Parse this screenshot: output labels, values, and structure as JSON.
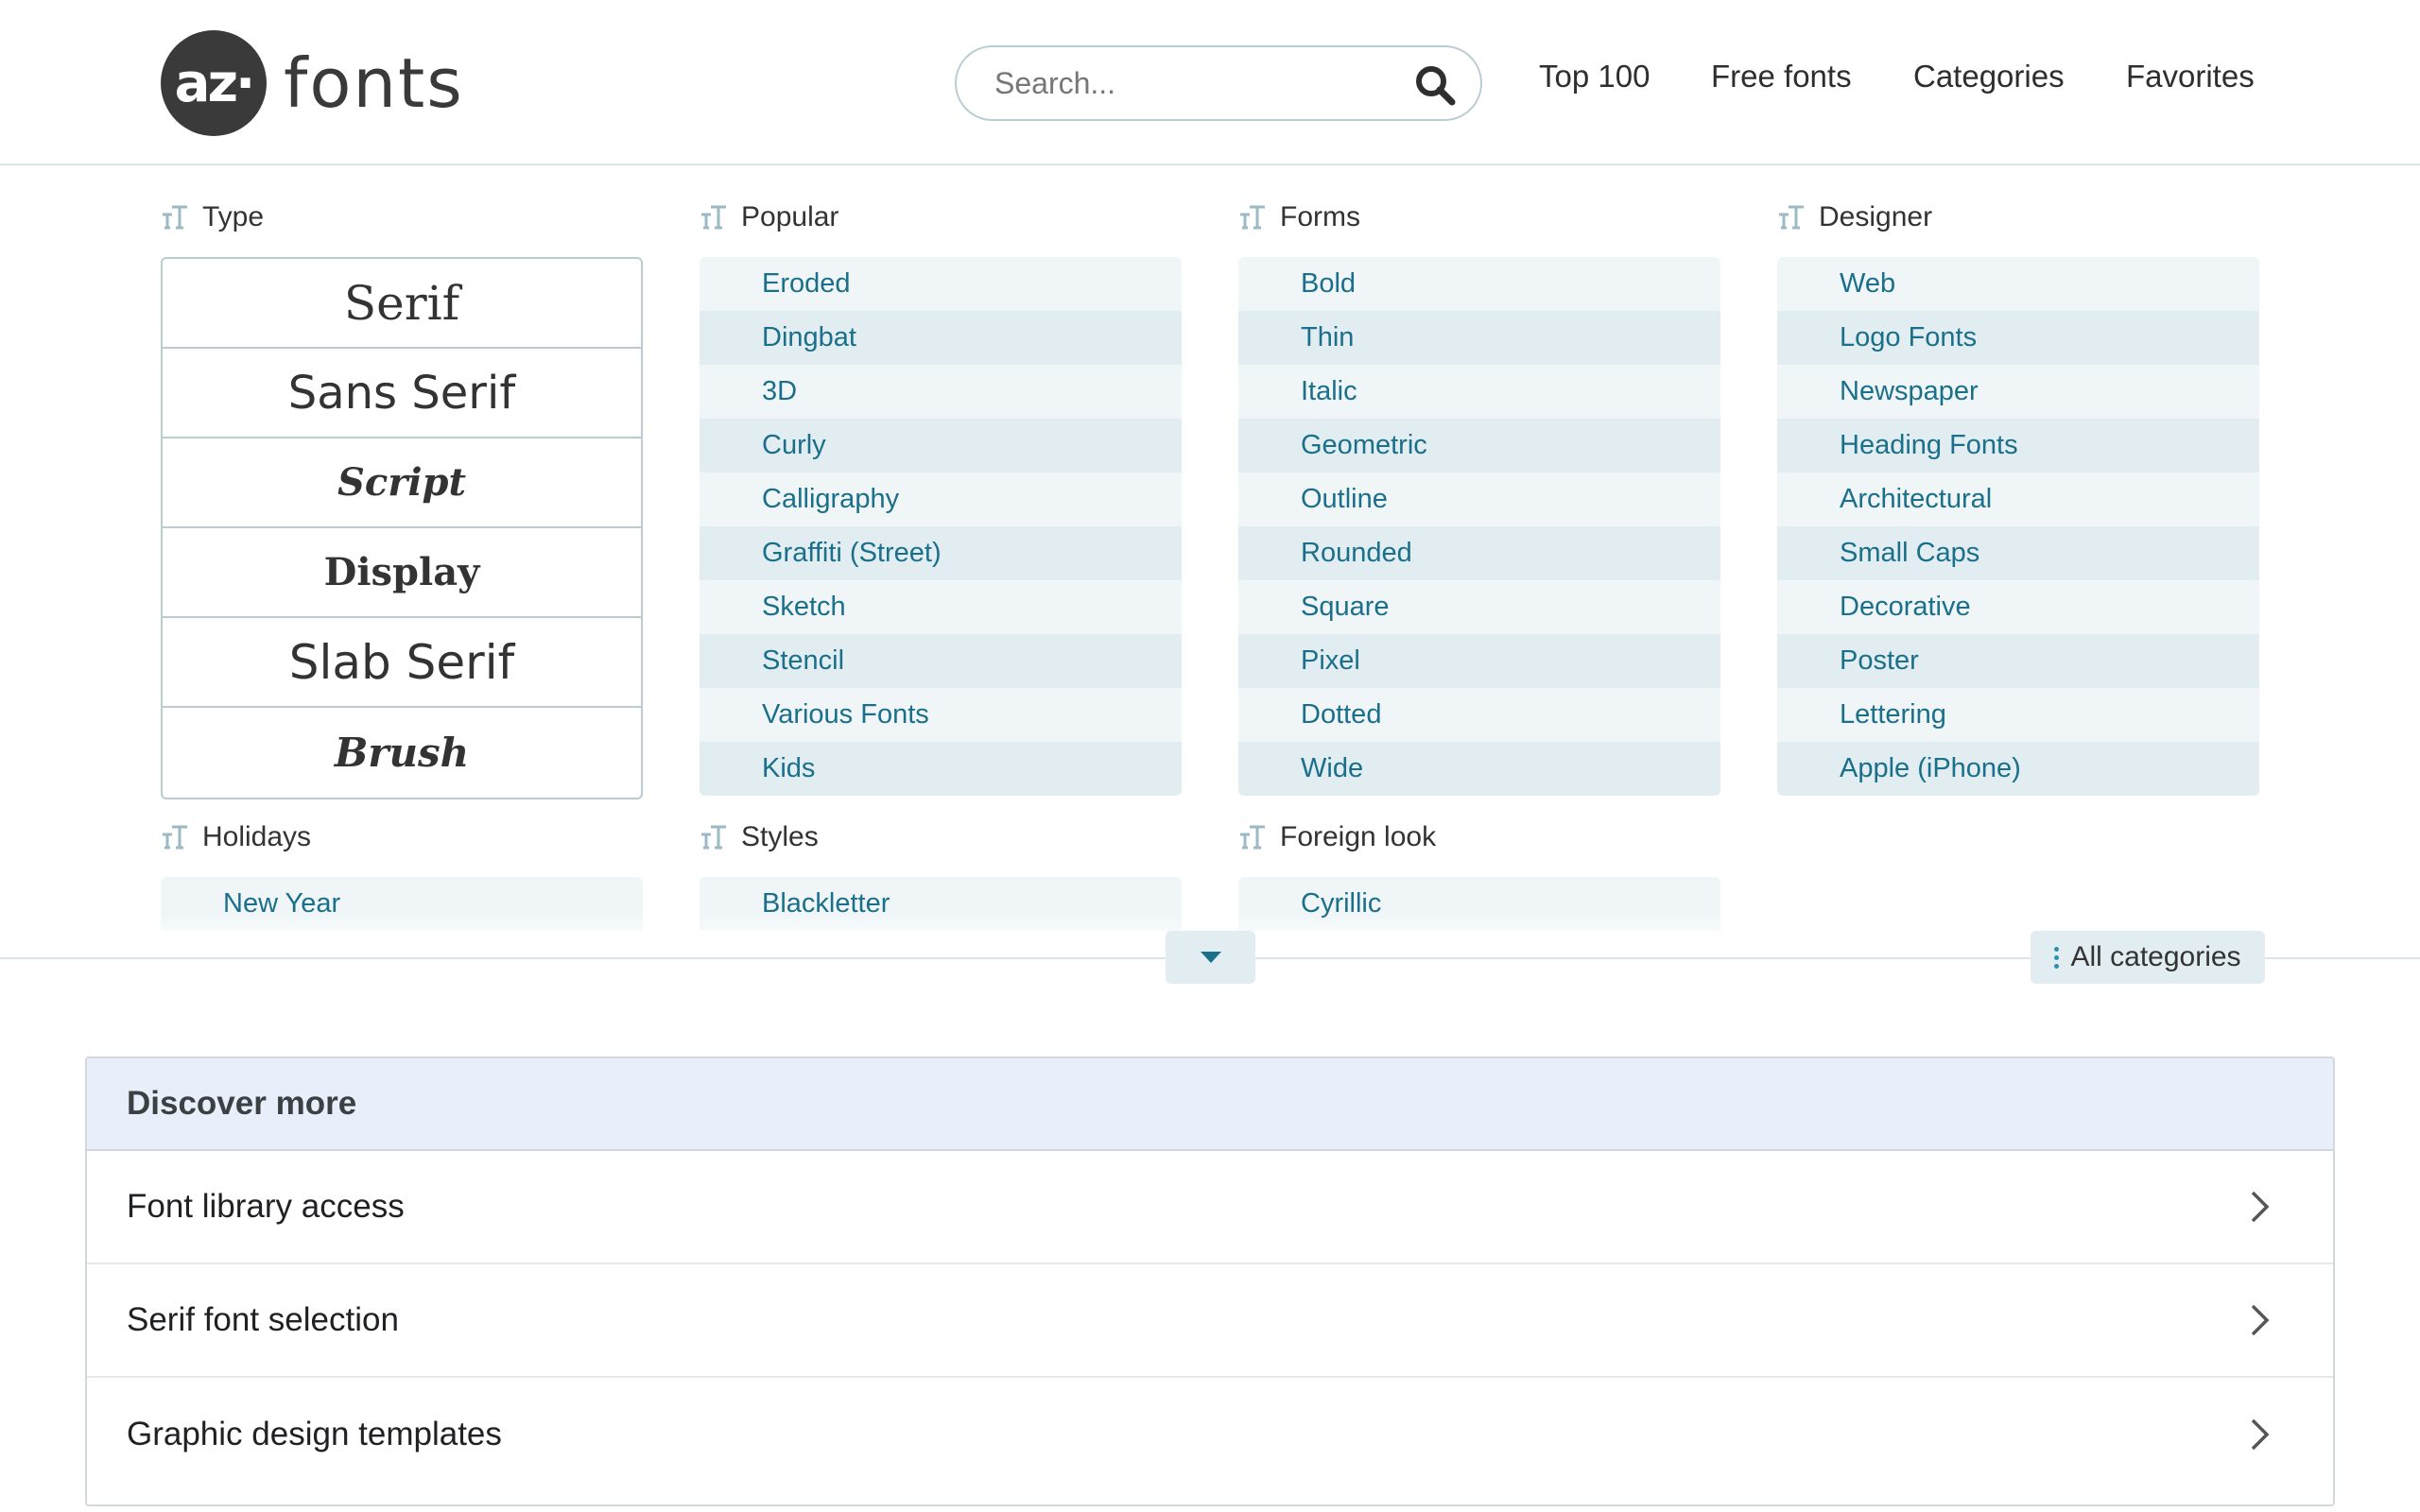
{
  "header": {
    "logo_badge": "az·",
    "logo_text": "fonts",
    "search_placeholder": "Search...",
    "nav": [
      "Top 100",
      "Free fonts",
      "Categories",
      "Favorites"
    ]
  },
  "columns": {
    "type": {
      "title": "Type",
      "items": [
        "Serif",
        "Sans Serif",
        "Script",
        "Display",
        "Slab Serif",
        "Brush"
      ]
    },
    "popular": {
      "title": "Popular",
      "items": [
        "Eroded",
        "Dingbat",
        "3D",
        "Curly",
        "Calligraphy",
        "Graffiti (Street)",
        "Sketch",
        "Stencil",
        "Various Fonts",
        "Kids"
      ]
    },
    "forms": {
      "title": "Forms",
      "items": [
        "Bold",
        "Thin",
        "Italic",
        "Geometric",
        "Outline",
        "Rounded",
        "Square",
        "Pixel",
        "Dotted",
        "Wide"
      ]
    },
    "designer": {
      "title": "Designer",
      "items": [
        "Web",
        "Logo Fonts",
        "Newspaper",
        "Heading Fonts",
        "Architectural",
        "Small Caps",
        "Decorative",
        "Poster",
        "Lettering",
        "Apple (iPhone)"
      ]
    },
    "holidays": {
      "title": "Holidays",
      "items": [
        "New Year"
      ]
    },
    "styles": {
      "title": "Styles",
      "items": [
        "Blackletter"
      ]
    },
    "foreign": {
      "title": "Foreign look",
      "items": [
        "Cyrillic"
      ]
    }
  },
  "all_categories_label": "All categories",
  "discover": {
    "title": "Discover more",
    "items": [
      "Font library access",
      "Serif font selection",
      "Graphic design templates"
    ]
  },
  "colors": {
    "link": "#1a6f8a",
    "list_bg_light": "#f0f6f8",
    "list_bg_dark": "#e2edf1",
    "discover_head_bg": "#e8effb"
  }
}
